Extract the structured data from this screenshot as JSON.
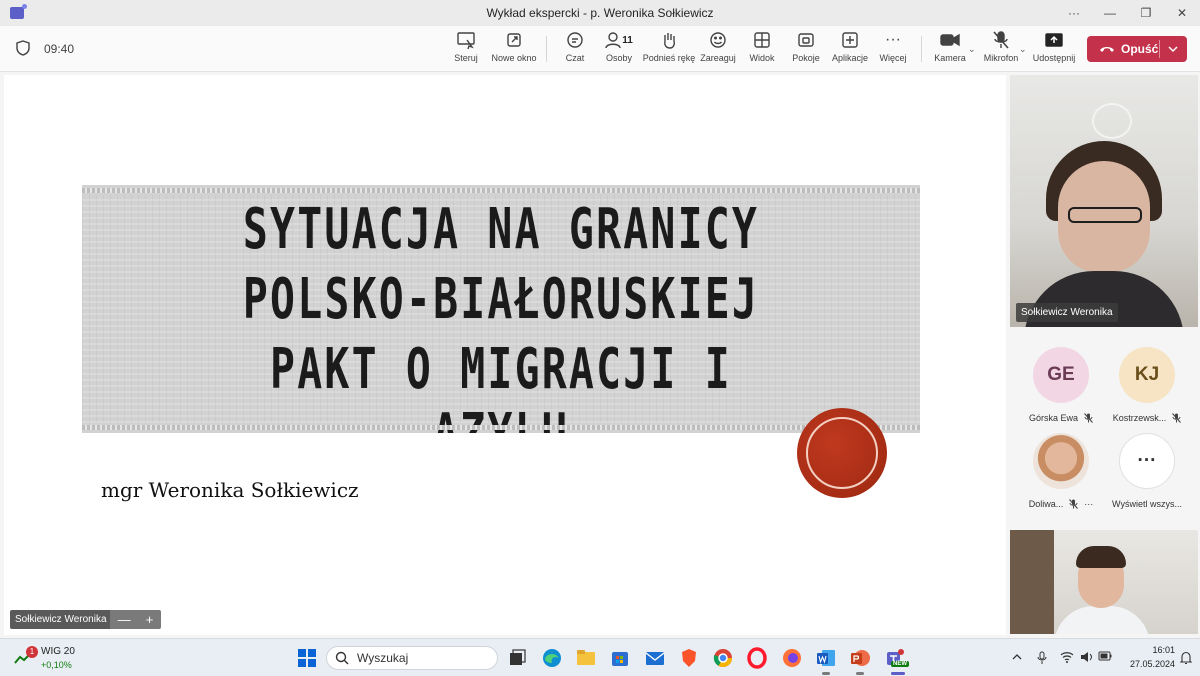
{
  "window": {
    "title": "Wykład ekspercki - p. Weronika Sołkiewicz",
    "more": "···",
    "minimize": "—",
    "maximize": "❐",
    "close": "✕"
  },
  "toolbar": {
    "time": "09:40",
    "buttons": [
      {
        "id": "steruj",
        "label": "Steruj"
      },
      {
        "id": "nowe-okno",
        "label": "Nowe okno"
      },
      {
        "id": "czat",
        "label": "Czat"
      },
      {
        "id": "osoby",
        "label": "Osoby",
        "count": "11"
      },
      {
        "id": "podnies-reke",
        "label": "Podnieś rękę"
      },
      {
        "id": "zareaguj",
        "label": "Zareaguj"
      },
      {
        "id": "widok",
        "label": "Widok"
      },
      {
        "id": "pokoje",
        "label": "Pokoje"
      },
      {
        "id": "aplikacje",
        "label": "Aplikacje"
      },
      {
        "id": "wiecej",
        "label": "Więcej"
      },
      {
        "id": "kamera",
        "label": "Kamera"
      },
      {
        "id": "mikrofon",
        "label": "Mikrofon"
      },
      {
        "id": "udostepnij",
        "label": "Udostępnij"
      }
    ],
    "leave_label": "Opuść",
    "leave_color": "#c4314b"
  },
  "slide": {
    "title_lines": [
      "SYTUACJA NA GRANICY",
      "POLSKO-BIAŁORUSKIEJ",
      "PAKT O MIGRACJI I AZYLU"
    ],
    "author": "mgr Weronika Sołkiewicz",
    "presenter_tag": "Sołkiewicz Weronika",
    "zoom_out": "—",
    "zoom_in": "+"
  },
  "participants": {
    "main_video_name": "Sołkiewicz Weronika",
    "list": [
      {
        "initials": "GE",
        "name": "Górska Ewa"
      },
      {
        "initials": "KJ",
        "name": "Kostrzewsk..."
      },
      {
        "initials": "",
        "name": "Doliwa..."
      },
      {
        "initials": "···",
        "name": "Wyświetl wszys..."
      }
    ]
  },
  "taskbar": {
    "widget_title": "WIG 20",
    "widget_value": "+0,10%",
    "widget_badge": "1",
    "search_label": "Wyszukaj",
    "time": "16:01",
    "date": "27.05.2024",
    "teams_badge": "NEW"
  }
}
